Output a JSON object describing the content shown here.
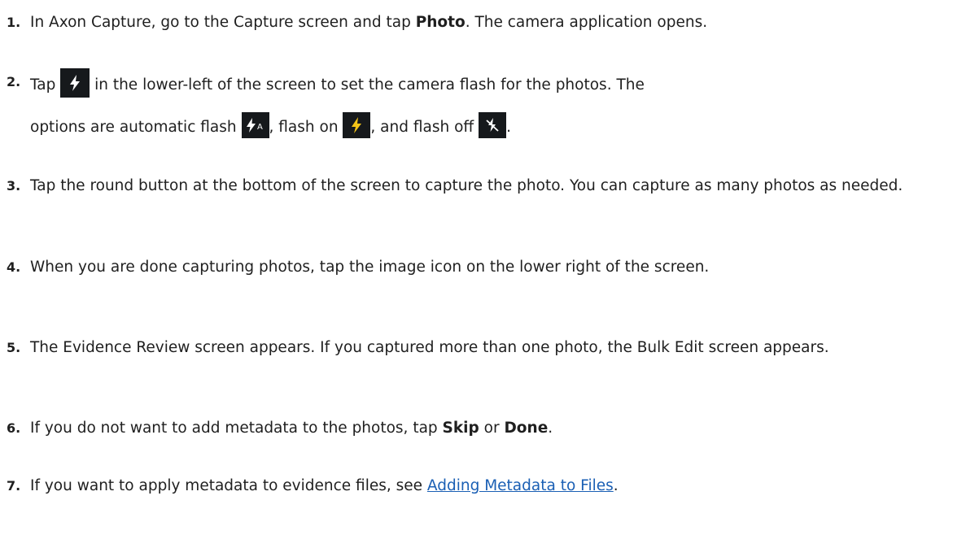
{
  "colors": {
    "text": "#1f1f1f",
    "link": "#1a5fb4",
    "icon_bg": "#16191c",
    "bolt_white": "#ffffff",
    "bolt_yellow": "#f5c518"
  },
  "steps": [
    {
      "number": "1.",
      "pre": "In Axon Capture, go to the Capture screen and tap ",
      "bold": "Photo",
      "post": ". The camera application opens."
    },
    {
      "number": "2.",
      "line1_pre": "Tap ",
      "line1_post": " in the lower-left of the screen to set the camera flash for the photos. The",
      "line2_a": "options are automatic flash ",
      "line2_b": ", flash on ",
      "line2_c": ", and flash off ",
      "line2_d": ".",
      "icons": [
        "flash-icon",
        "flash-auto-icon",
        "flash-on-icon",
        "flash-off-icon"
      ],
      "flash_auto_letter": "A"
    },
    {
      "number": "3.",
      "text": "Tap the round button at the bottom of the screen to capture the photo. You can capture as many photos as needed."
    },
    {
      "number": "4.",
      "text": "When you are done capturing photos, tap the image icon on the lower right of the screen."
    },
    {
      "number": "5.",
      "text": "The Evidence Review screen appears. If you captured more than one photo, the Bulk Edit screen appears."
    },
    {
      "number": "6.",
      "pre": "If you do not want to add metadata to the photos, tap ",
      "bold1": "Skip",
      "mid": " or ",
      "bold2": "Done",
      "post": "."
    },
    {
      "number": "7.",
      "pre": "If you want to apply metadata to evidence files, see ",
      "link": "Adding Metadata to Files",
      "post": "."
    }
  ]
}
